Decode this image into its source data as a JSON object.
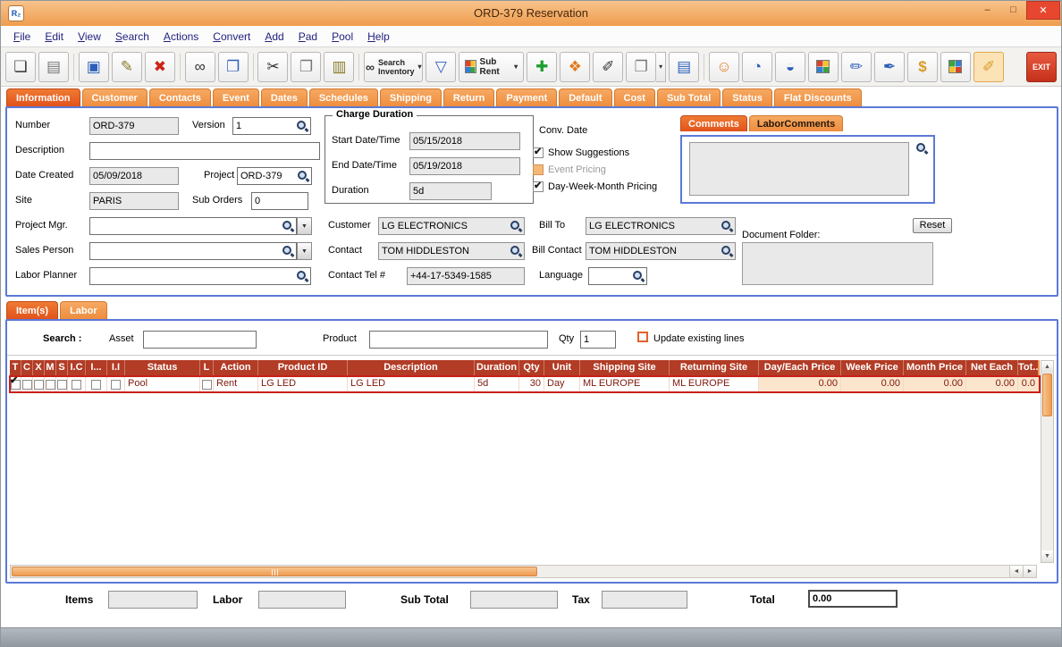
{
  "window": {
    "title": "ORD-379 Reservation",
    "app_icon_text": "R₂"
  },
  "menu": {
    "items": [
      "File",
      "Edit",
      "View",
      "Search",
      "Actions",
      "Convert",
      "Add",
      "Pad",
      "Pool",
      "Help"
    ]
  },
  "ui": {
    "glyphs": {
      "minimize": "–",
      "maximize": "□",
      "close": "✕",
      "dropdown": "▾",
      "combo_down": "▼",
      "up": "▲",
      "down": "▼",
      "left": "◄",
      "right": "►"
    }
  },
  "toolbar": {
    "icons": {
      "new": "❏",
      "print": "▤",
      "save": "▣",
      "edit": "✎",
      "delete": "✖",
      "find": "∞",
      "search_document": "❐",
      "cut": "✂",
      "copy": "❐",
      "paste": "▥",
      "filter": "▽",
      "add": "✚",
      "kit": "❖",
      "note": "✐",
      "duplicate": "❐",
      "print_preview": "▤",
      "smiley": "☺",
      "history": "◔",
      "export": "◒",
      "edit_document": "✏",
      "key": "✒",
      "money": "$",
      "wand": "✐"
    },
    "search_inventory_line1": "Search",
    "search_inventory_line2": "Inventory",
    "sub_rent_label": "Sub Rent",
    "exit_label": "EXIT"
  },
  "tabs": {
    "items": [
      "Information",
      "Customer",
      "Contacts",
      "Event",
      "Dates",
      "Schedules",
      "Shipping",
      "Return",
      "Payment",
      "Default",
      "Cost",
      "Sub Total",
      "Status",
      "Flat Discounts"
    ],
    "active": "Information"
  },
  "form": {
    "number_label": "Number",
    "number_value": "ORD-379",
    "version_label": "Version",
    "version_value": "1",
    "description_label": "Description",
    "description_value": "",
    "date_created_label": "Date Created",
    "date_created_value": "05/09/2018",
    "project_label": "Project",
    "project_value": "ORD-379",
    "site_label": "Site",
    "site_value": "PARIS",
    "sub_orders_label": "Sub Orders",
    "sub_orders_value": "0",
    "project_mgr_label": "Project Mgr.",
    "project_mgr_value": "",
    "sales_person_label": "Sales Person",
    "sales_person_value": "",
    "labor_planner_label": "Labor Planner",
    "labor_planner_value": "",
    "charge_duration_title": "Charge Duration",
    "start_label": "Start Date/Time",
    "start_value": "05/15/2018",
    "end_label": "End Date/Time",
    "end_value": "05/19/2018",
    "duration_label": "Duration",
    "duration_value": "5d",
    "conv_date_label": "Conv. Date",
    "show_suggestions_label": "Show Suggestions",
    "show_suggestions_checked": true,
    "event_pricing_label": "Event Pricing",
    "event_pricing_enabled": false,
    "day_week_month_label": "Day-Week-Month Pricing",
    "day_week_month_checked": true,
    "comments_tab": "Comments",
    "labor_comments_tab": "LaborComments",
    "comments_value": "",
    "customer_label": "Customer",
    "customer_value": "LG ELECTRONICS",
    "bill_to_label": "Bill To",
    "bill_to_value": "LG ELECTRONICS",
    "contact_label": "Contact",
    "contact_value": "TOM HIDDLESTON",
    "bill_contact_label": "Bill Contact",
    "bill_contact_value": "TOM HIDDLESTON",
    "contact_tel_label": "Contact Tel #",
    "contact_tel_value": "+44-17-5349-1585",
    "language_label": "Language",
    "language_value": "",
    "document_folder_label": "Document Folder:",
    "reset_button": "Reset"
  },
  "items_section": {
    "tabs": [
      "Item(s)",
      "Labor"
    ],
    "search_label": "Search :",
    "asset_label": "Asset",
    "asset_value": "",
    "product_label": "Product",
    "product_value": "",
    "qty_label": "Qty",
    "qty_value": "1",
    "update_lines_label": "Update existing lines",
    "update_lines_checked": false,
    "table": {
      "headers": [
        "T",
        "C",
        "X",
        "M",
        "S",
        "I.C",
        "I...",
        "I.I",
        "Status",
        "L",
        "Action",
        "Product ID",
        "Description",
        "Duration",
        "Qty",
        "Unit",
        "Shipping Site",
        "Returning Site",
        "Day/Each Price",
        "Week Price",
        "Month Price",
        "Net Each",
        "Tot..."
      ],
      "row": {
        "checked_columns": [
          "T",
          "C"
        ],
        "status": "Pool",
        "action": "Rent",
        "product_id": "LG LED",
        "description": "LG LED",
        "duration": "5d",
        "qty": "30",
        "unit": "Day",
        "shipping_site": "ML EUROPE",
        "returning_site": "ML EUROPE",
        "day_each_price": "0.00",
        "week_price": "0.00",
        "month_price": "0.00",
        "net_each": "0.00",
        "tot": "0.0"
      }
    }
  },
  "totals": {
    "items_label": "Items",
    "items_value": "",
    "labor_label": "Labor",
    "labor_value": "",
    "sub_total_label": "Sub Total",
    "sub_total_value": "",
    "tax_label": "Tax",
    "tax_value": "",
    "total_label": "Total",
    "total_value": "0.00"
  }
}
